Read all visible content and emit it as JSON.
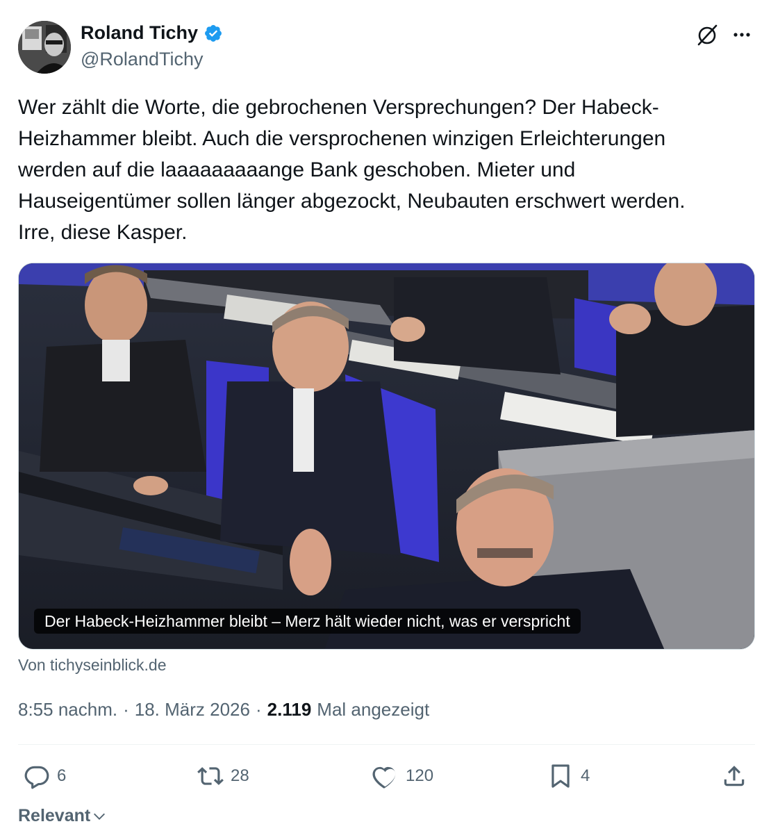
{
  "author": {
    "name": "Roland Tichy",
    "handle": "@RolandTichy",
    "verified": true
  },
  "icons": {
    "verified": "verified-badge-icon",
    "grok": "grok-icon",
    "more": "more-icon",
    "reply": "reply-icon",
    "retweet": "retweet-icon",
    "like": "like-icon",
    "bookmark": "bookmark-icon",
    "share": "share-icon",
    "chevron": "chevron-down-icon"
  },
  "tweet": {
    "text": "Wer zählt die Worte, die gebrochenen Versprechungen? Der Habeck-\nHeizhammer bleibt. Auch die versprochenen winzigen Erleichterungen\nwerden auf die laaaaaaaaange Bank geschoben. Mieter und\nHauseigentümer sollen länger abgezockt, Neubauten erschwert werden.\nIrre, diese Kasper."
  },
  "card": {
    "caption": "Der Habeck-Heizhammer bleibt – Merz hält wieder nicht, was er verspricht",
    "source": "Von tichyseinblick.de"
  },
  "meta": {
    "time": "8:55 nachm.",
    "sep1": "·",
    "date": "18. März 2026",
    "sep2": "·",
    "views_count": "2.119",
    "views_label": "Mal angezeigt"
  },
  "actions": {
    "replies": "6",
    "retweets": "28",
    "likes": "120",
    "bookmarks": "4"
  },
  "sort": {
    "label": "Relevant"
  },
  "colors": {
    "text": "#0f1419",
    "secondary": "#536471",
    "verified": "#1d9bf0",
    "border": "#cfd9de"
  }
}
